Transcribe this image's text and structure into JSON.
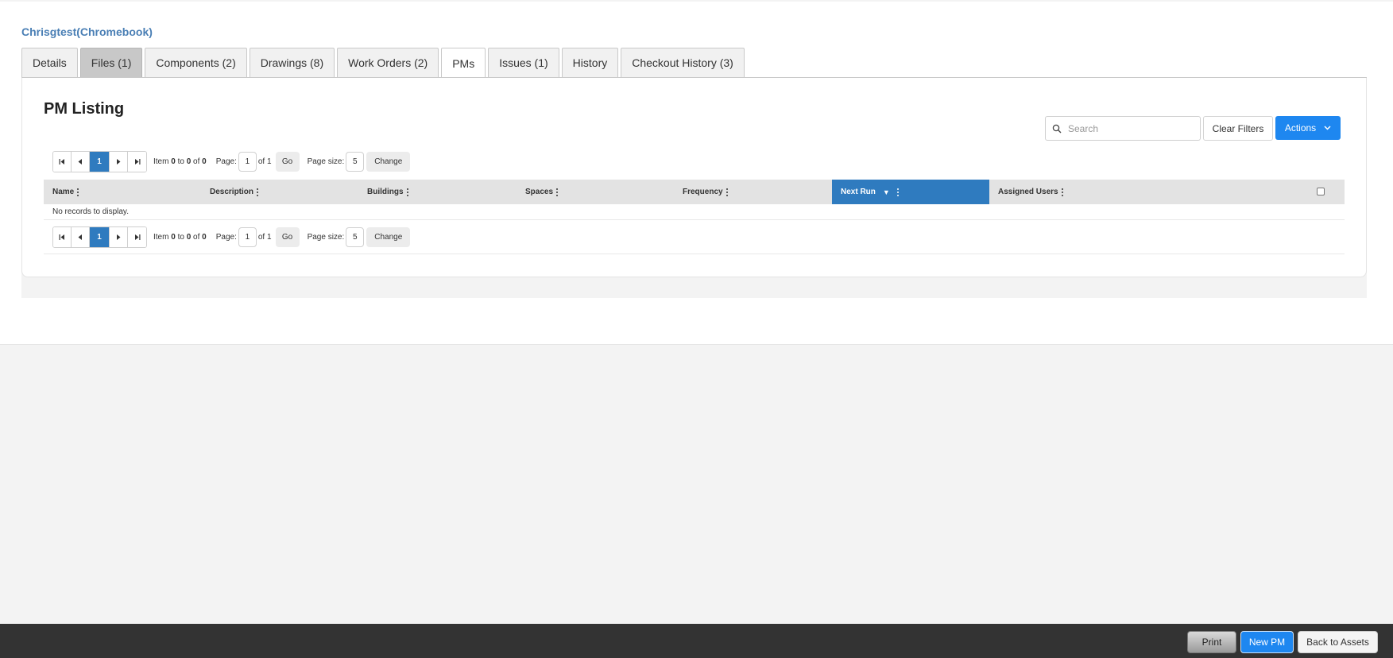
{
  "asset": {
    "title": "Chrisgtest(Chromebook)"
  },
  "tabs": [
    {
      "label": "Details"
    },
    {
      "label": "Files (1)"
    },
    {
      "label": "Components (2)"
    },
    {
      "label": "Drawings (8)"
    },
    {
      "label": "Work Orders (2)"
    },
    {
      "label": "PMs"
    },
    {
      "label": "Issues (1)"
    },
    {
      "label": "History"
    },
    {
      "label": "Checkout History (3)"
    }
  ],
  "panel": {
    "title": "PM Listing",
    "search_placeholder": "Search",
    "clear_filters_label": "Clear Filters",
    "actions_label": "Actions"
  },
  "pager": {
    "current_page": "1",
    "item_prefix": "Item",
    "item_from": "0",
    "item_to_word": "to",
    "item_to": "0",
    "item_of_word": "of",
    "item_total": "0",
    "page_label": "Page:",
    "page_value": "1",
    "page_of": "of 1",
    "go_label": "Go",
    "page_size_label": "Page size:",
    "page_size_value": "5",
    "change_label": "Change"
  },
  "grid": {
    "columns": [
      {
        "label": "Name"
      },
      {
        "label": "Description"
      },
      {
        "label": "Buildings"
      },
      {
        "label": "Spaces"
      },
      {
        "label": "Frequency"
      },
      {
        "label": "Next Run",
        "sorted": "descending"
      },
      {
        "label": "Assigned Users"
      }
    ],
    "empty_text": "No records to display."
  },
  "footer": {
    "print_label": "Print",
    "new_pm_label": "New PM",
    "back_label": "Back to Assets"
  },
  "colors": {
    "accent": "#1e87f0",
    "sorted_header": "#2f7bbf",
    "title_link": "#4a7fb5",
    "footer_bg": "#333333"
  },
  "icons": {
    "search": "search-icon",
    "first": "first-page-icon",
    "prev": "prev-page-icon",
    "next": "next-page-icon",
    "last": "last-page-icon",
    "column_menu": "kebab-menu-icon",
    "sort": "sort-descending-icon",
    "actions_dropdown": "chevron-down-icon"
  }
}
